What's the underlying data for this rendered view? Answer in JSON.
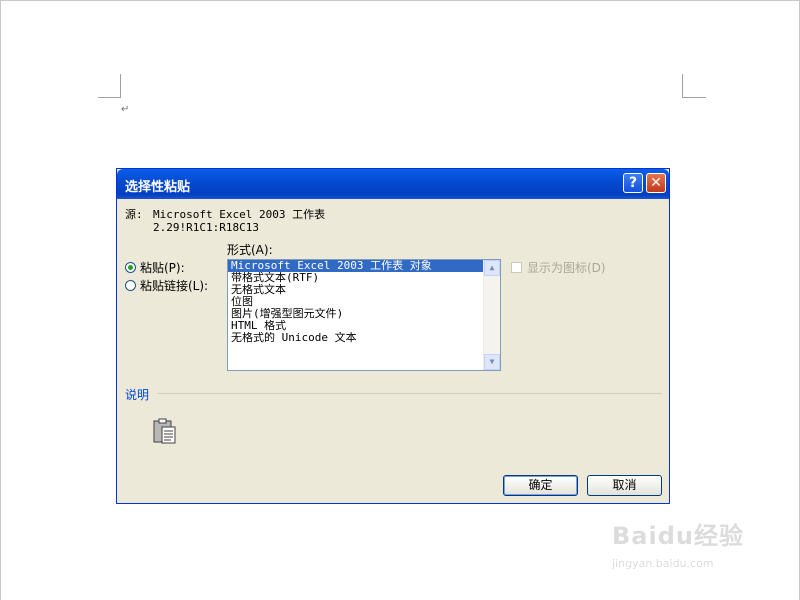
{
  "dialog": {
    "title": "选择性粘贴",
    "help_label": "?",
    "close_label": "✕",
    "source_label": "源:",
    "source_value": "Microsoft Excel 2003 工作表",
    "source_range": "2.29!R1C1:R18C13",
    "format_label": "形式(A):",
    "options": {
      "paste": "粘贴(P):",
      "paste_link": "粘贴链接(L):"
    },
    "formats": [
      "Microsoft Excel 2003 工作表 对象",
      "带格式文本(RTF)",
      "无格式文本",
      "位图",
      "图片(增强型图元文件)",
      "HTML 格式",
      "无格式的 Unicode 文本"
    ],
    "selected_format_index": 0,
    "display_as_icon_label": "显示为图标(D)",
    "description_label": "说明",
    "ok_label": "确定",
    "cancel_label": "取消"
  },
  "watermark": {
    "logo": "Baidu经验",
    "url": "jingyan.baidu.com"
  },
  "icons": {
    "paragraph_mark": "↵",
    "clipboard": "clipboard-icon"
  }
}
